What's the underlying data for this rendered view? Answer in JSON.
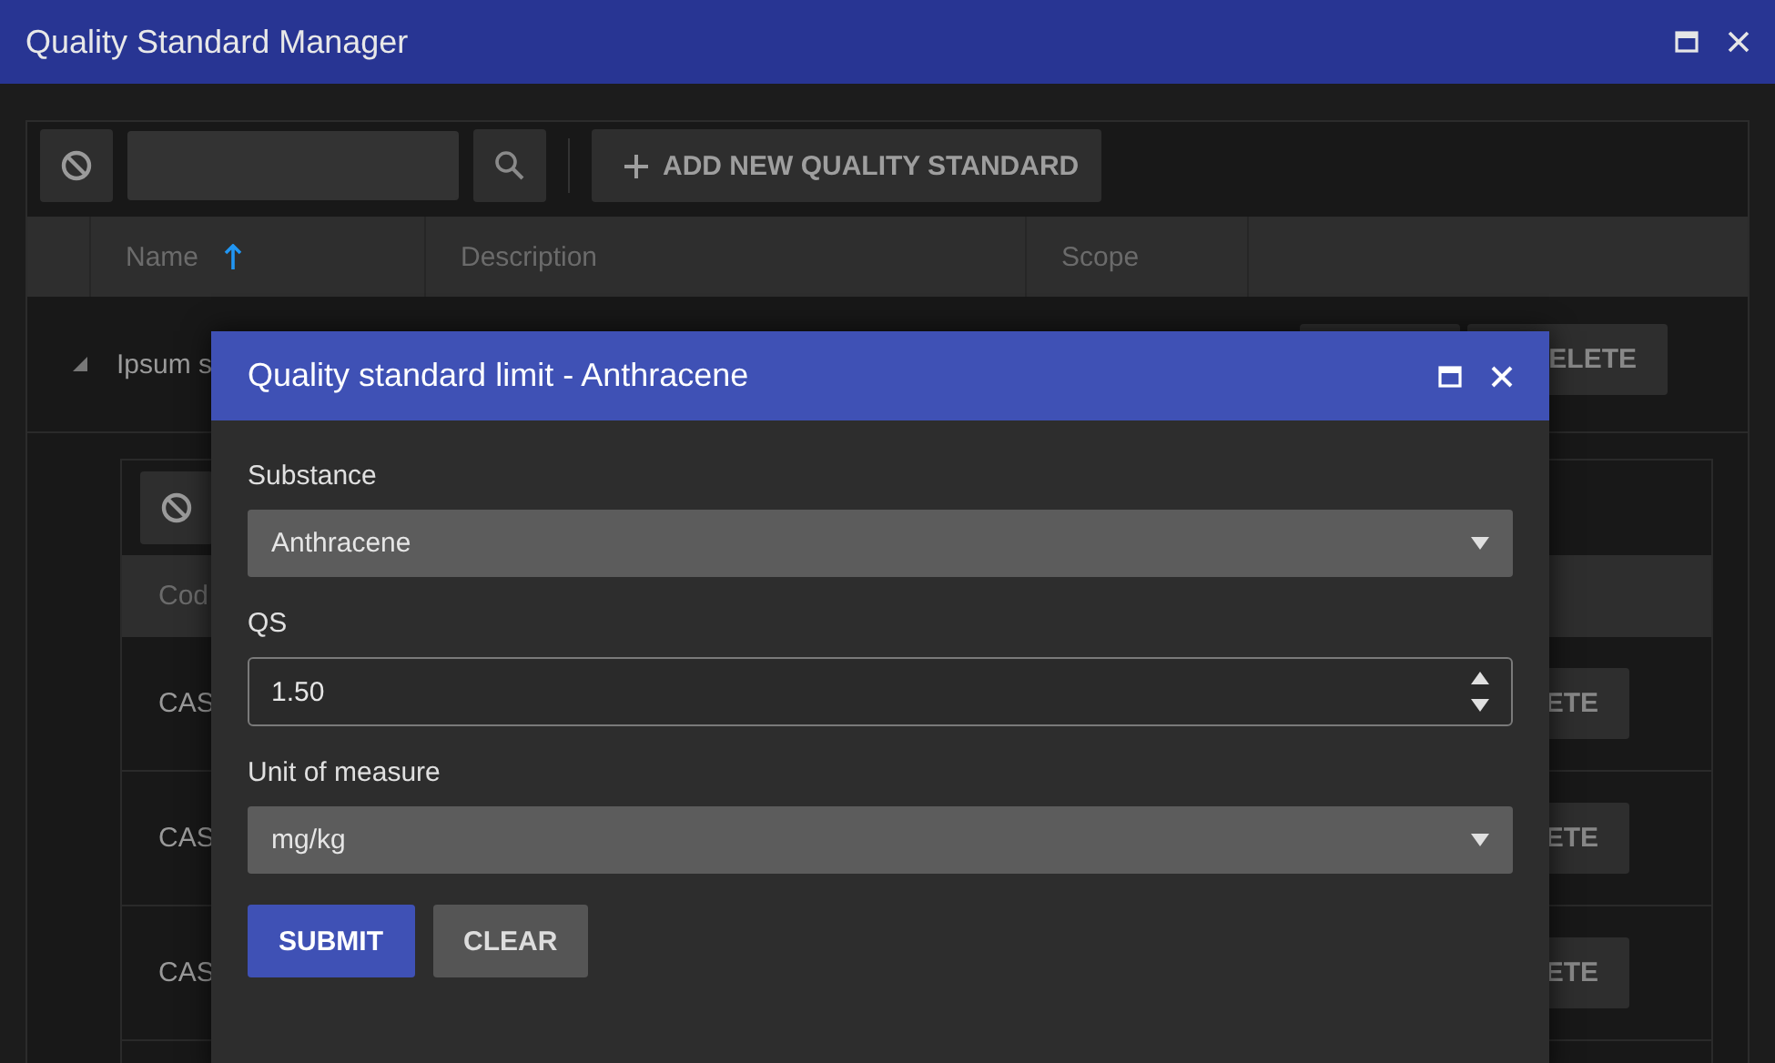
{
  "window": {
    "title": "Quality Standard Manager"
  },
  "toolbar": {
    "add_button": "ADD NEW QUALITY STANDARD"
  },
  "table": {
    "columns": [
      {
        "label": "Name",
        "sorted": true
      },
      {
        "label": "Description",
        "sorted": false
      },
      {
        "label": "Scope",
        "sorted": false
      }
    ],
    "rows": [
      {
        "name": "Ipsum s",
        "expanded": true,
        "delete_label": "ELETE"
      }
    ]
  },
  "nested_table": {
    "columns": [
      "Cod"
    ],
    "rows": [
      {
        "code": "CAS",
        "delete_label": "ETE"
      },
      {
        "code": "CAS",
        "delete_label": "ETE"
      },
      {
        "code": "CAS",
        "delete_label": "ETE"
      }
    ]
  },
  "dialog": {
    "title": "Quality standard limit - Anthracene",
    "fields": [
      {
        "kind": "select",
        "label": "Substance",
        "value": "Anthracene"
      },
      {
        "kind": "number",
        "label": "QS",
        "value": "1.50"
      },
      {
        "kind": "select",
        "label": "Unit of measure",
        "value": "mg/kg"
      }
    ],
    "buttons": [
      {
        "label": "SUBMIT",
        "primary": true
      },
      {
        "label": "CLEAR",
        "primary": false
      }
    ]
  }
}
